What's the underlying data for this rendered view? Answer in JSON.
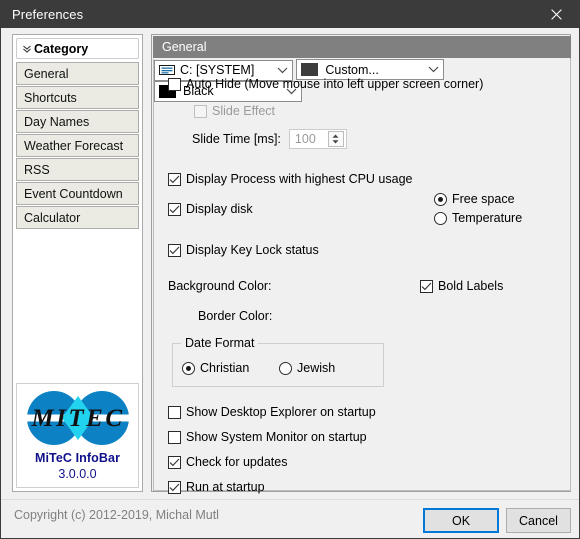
{
  "window": {
    "title": "Preferences",
    "close_icon": "close-icon"
  },
  "sidebar": {
    "header": {
      "label": "Category",
      "icon": "chevron-double-down-icon"
    },
    "items": [
      {
        "label": "General"
      },
      {
        "label": "Shortcuts"
      },
      {
        "label": "Day Names"
      },
      {
        "label": "Weather Forecast"
      },
      {
        "label": "RSS"
      },
      {
        "label": "Event Countdown"
      },
      {
        "label": "Calculator"
      }
    ],
    "branding": {
      "logo_icon": "mitec-logo",
      "logo_text": "MITEC",
      "product": "MiTeC InfoBar",
      "version": "3.0.0.0",
      "logo_blue": "#0c82c4",
      "logo_cyan": "#22d3f0",
      "text_color": "#10108c"
    }
  },
  "main": {
    "header": "General",
    "auto_hide": {
      "label": "Auto Hide (Move mouse into left upper screen corner)",
      "checked": false
    },
    "slide_effect": {
      "label": "Slide Effect",
      "checked": false,
      "disabled": true
    },
    "slide_time": {
      "label": "Slide Time [ms]:",
      "value": "100",
      "disabled": true
    },
    "display_process": {
      "label": "Display Process with highest CPU usage",
      "checked": true
    },
    "display_disk": {
      "label": "Display disk",
      "checked": true,
      "selected": "C: [SYSTEM]",
      "icon": "drive-icon"
    },
    "disk_mode": {
      "options": [
        {
          "label": "Free space",
          "selected": true
        },
        {
          "label": "Temperature",
          "selected": false
        }
      ]
    },
    "display_key_lock": {
      "label": "Display Key Lock status",
      "checked": true
    },
    "background_color": {
      "label": "Background Color:",
      "selected": "Custom...",
      "swatch": "#3c3c3c"
    },
    "border_color": {
      "label": "Border Color:",
      "selected": "Black",
      "swatch": "#000000"
    },
    "bold_labels": {
      "label": "Bold Labels",
      "checked": true
    },
    "date_format": {
      "title": "Date Format",
      "options": [
        {
          "label": "Christian",
          "selected": true
        },
        {
          "label": "Jewish",
          "selected": false
        }
      ]
    },
    "startup_options": [
      {
        "label": "Show Desktop Explorer on startup",
        "checked": false
      },
      {
        "label": "Show System Monitor on startup",
        "checked": false
      },
      {
        "label": "Check for updates",
        "checked": true
      },
      {
        "label": "Run at startup",
        "checked": true
      }
    ]
  },
  "footer": {
    "copyright": "Copyright (c) 2012-2019, Michal Mutl",
    "ok_label": "OK",
    "cancel_label": "Cancel",
    "accent": "#0078d7"
  }
}
